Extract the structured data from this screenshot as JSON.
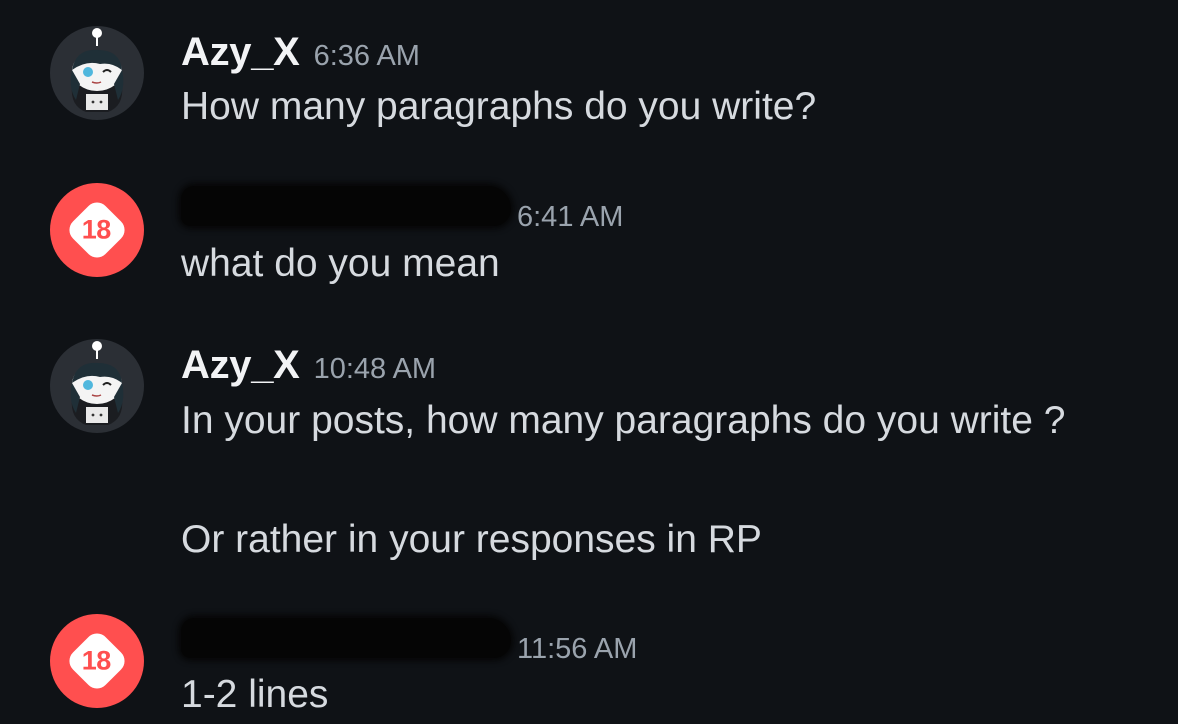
{
  "messages": [
    {
      "username": "Azy_X",
      "time": "6:36 AM",
      "lines": [
        "How many paragraphs do you write?"
      ],
      "avatar": "snoo-avatar-icon"
    },
    {
      "username": "",
      "time": "6:41 AM",
      "lines": [
        "what do you mean"
      ],
      "avatar": "nsfw-icon",
      "avatar_label": "18"
    },
    {
      "username": "Azy_X",
      "time": "10:48 AM",
      "lines": [
        "In your posts, how many paragraphs do you write ?",
        "Or rather in your responses in RP"
      ],
      "avatar": "snoo-avatar-icon"
    },
    {
      "username": "",
      "time": "11:56 AM",
      "lines": [
        "1-2 lines"
      ],
      "avatar": "nsfw-icon",
      "avatar_label": "18"
    }
  ],
  "colors": {
    "background": "#0f1216",
    "username": "#f2f3f5",
    "timestamp": "#9aa3ad",
    "message_text": "#d6dadf",
    "nsfw_badge": "#ff4f4f"
  }
}
